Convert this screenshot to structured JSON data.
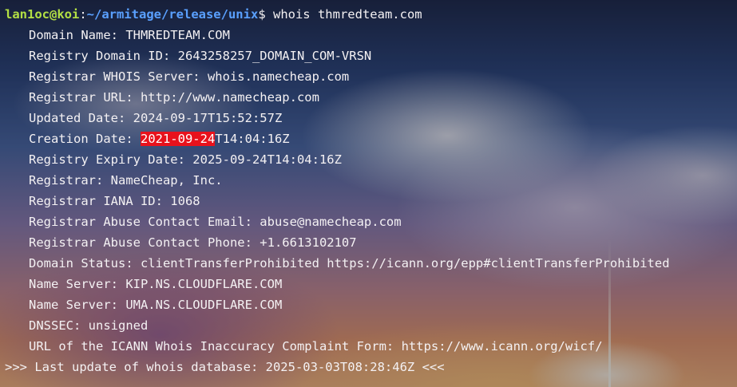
{
  "prompt": {
    "user_host": "lan1oc@koi",
    "separator": ":",
    "path": "~/armitage/release/unix",
    "symbol": "$ ",
    "command": "whois thmredteam.com"
  },
  "whois": {
    "domain_name": "Domain Name: THMREDTEAM.COM",
    "registry_domain_id": "Registry Domain ID: 2643258257_DOMAIN_COM-VRSN",
    "registrar_whois_server": "Registrar WHOIS Server: whois.namecheap.com",
    "registrar_url": "Registrar URL: http://www.namecheap.com",
    "updated_date": "Updated Date: 2024-09-17T15:52:57Z",
    "creation_label": "Creation Date: ",
    "creation_date_highlight": "2021-09-24",
    "creation_time": "T14:04:16Z",
    "registry_expiry_date": "Registry Expiry Date: 2025-09-24T14:04:16Z",
    "registrar": "Registrar: NameCheap, Inc.",
    "registrar_iana_id": "Registrar IANA ID: 1068",
    "abuse_email": "Registrar Abuse Contact Email: abuse@namecheap.com",
    "abuse_phone": "Registrar Abuse Contact Phone: +1.6613102107",
    "domain_status": "Domain Status: clientTransferProhibited https://icann.org/epp#clientTransferProhibited",
    "name_server_1": "Name Server: KIP.NS.CLOUDFLARE.COM",
    "name_server_2": "Name Server: UMA.NS.CLOUDFLARE.COM",
    "dnssec": "DNSSEC: unsigned",
    "icann_complaint": "URL of the ICANN Whois Inaccuracy Complaint Form: https://www.icann.org/wicf/",
    "last_update": ">>> Last update of whois database: 2025-03-03T08:28:46Z <<<"
  },
  "colors": {
    "user_host": "#b3e044",
    "path": "#5aa0ff",
    "highlight_bg": "#e8121c",
    "text": "#f4f1f3"
  }
}
